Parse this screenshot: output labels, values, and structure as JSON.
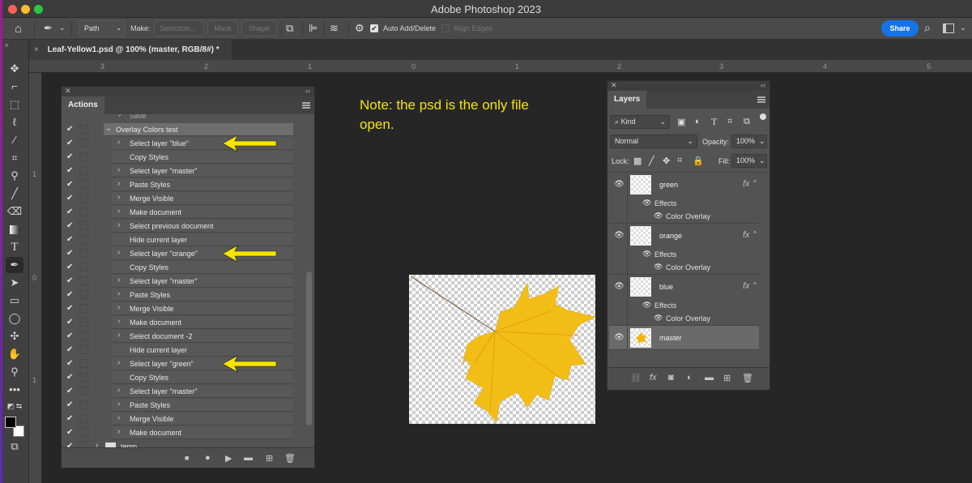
{
  "app": {
    "title": "Adobe Photoshop 2023"
  },
  "options_bar": {
    "mode_value": "Path",
    "make_label": "Make:",
    "selection_button": "Selection...",
    "mask_button": "Mask",
    "shape_button": "Shape",
    "auto_add_delete_label": "Auto Add/Delete",
    "auto_add_delete_checked": true,
    "align_edges_label": "Align Edges",
    "align_edges_checked": false,
    "share_button": "Share",
    "share_color": "#1473e6"
  },
  "document_tab": {
    "close": "×",
    "title": "Leaf-Yellow1.psd @ 100% (master, RGB/8#) *"
  },
  "rulers": {
    "horizontal_ticks": [
      "3",
      "2",
      "1",
      "0",
      "1",
      "2",
      "3",
      "4",
      "5"
    ],
    "vertical_ticks": [
      "1",
      "0",
      "1"
    ]
  },
  "actions_panel": {
    "tab": "Actions",
    "partial_top_item": "Save",
    "set_name": "Overlay Colors test",
    "items": [
      {
        "label": "Select layer \"blue\"",
        "expandable": true,
        "arrow": true
      },
      {
        "label": "Copy Styles",
        "expandable": false
      },
      {
        "label": "Select layer \"master\"",
        "expandable": true
      },
      {
        "label": "Paste Styles",
        "expandable": true
      },
      {
        "label": "Merge Visible",
        "expandable": true
      },
      {
        "label": "Make document",
        "expandable": true
      },
      {
        "label": "Select previous document",
        "expandable": true
      },
      {
        "label": "Hide current layer",
        "expandable": false
      },
      {
        "label": "Select layer \"orange\"",
        "expandable": true,
        "arrow": true
      },
      {
        "label": "Copy Styles",
        "expandable": false
      },
      {
        "label": "Select layer \"master\"",
        "expandable": true
      },
      {
        "label": "Paste Styles",
        "expandable": true
      },
      {
        "label": "Merge Visible",
        "expandable": true
      },
      {
        "label": "Make document",
        "expandable": true
      },
      {
        "label": "Select document -2",
        "expandable": true
      },
      {
        "label": "Hide current layer",
        "expandable": false
      },
      {
        "label": "Select layer \"green\"",
        "expandable": true,
        "arrow": true
      },
      {
        "label": "Copy Styles",
        "expandable": false
      },
      {
        "label": "Select layer \"master\"",
        "expandable": true
      },
      {
        "label": "Paste Styles",
        "expandable": true
      },
      {
        "label": "Merge Visible",
        "expandable": true
      },
      {
        "label": "Make document",
        "expandable": true
      }
    ],
    "bottom_set": "temp"
  },
  "note": {
    "text": "Note: the psd is the only file open.",
    "color": "#f5e400"
  },
  "layers_panel": {
    "tab": "Layers",
    "filter_kind": "Kind",
    "blend_mode": "Normal",
    "opacity_label": "Opacity:",
    "opacity_value": "100%",
    "lock_label": "Lock:",
    "fill_label": "Fill:",
    "fill_value": "100%",
    "layers": [
      {
        "name": "green",
        "fx": true,
        "effects_label": "Effects",
        "effect": "Color Overlay"
      },
      {
        "name": "orange",
        "fx": true,
        "effects_label": "Effects",
        "effect": "Color Overlay"
      },
      {
        "name": "blue",
        "fx": true,
        "effects_label": "Effects",
        "effect": "Color Overlay"
      },
      {
        "name": "master",
        "fx": false,
        "selected": true
      }
    ],
    "fx_symbol": "fx"
  }
}
